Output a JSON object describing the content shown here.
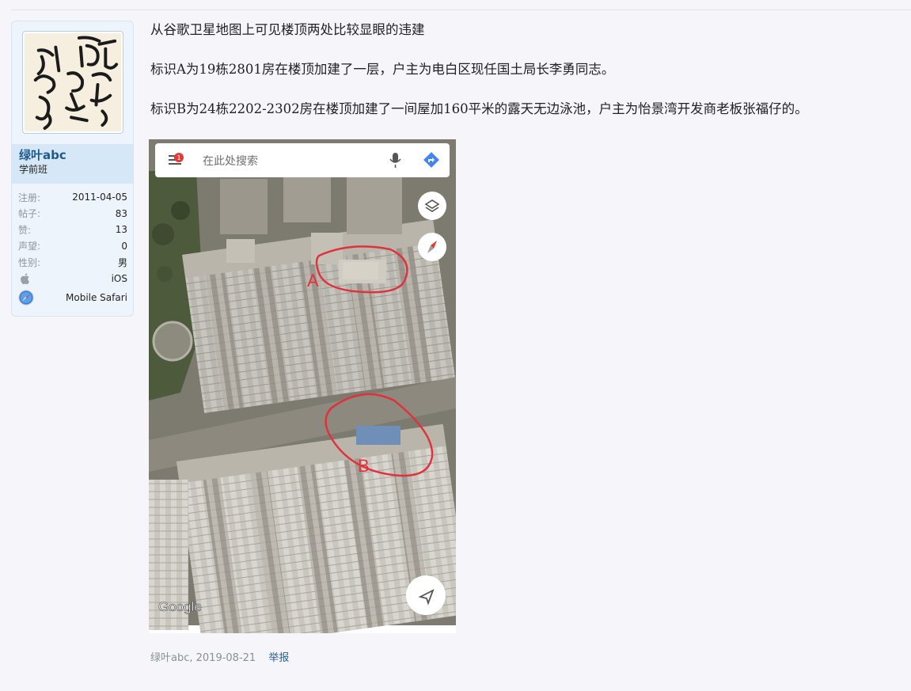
{
  "user": {
    "name": "绿叶abc",
    "title": "学前班",
    "stats": [
      {
        "label": "注册:",
        "value": "2011-04-05"
      },
      {
        "label": "帖子:",
        "value": "83"
      },
      {
        "label": "赞:",
        "value": "13"
      },
      {
        "label": "声望:",
        "value": "0"
      },
      {
        "label": "性别:",
        "value": "男"
      }
    ],
    "platform": {
      "icon": "apple-icon",
      "value": "iOS"
    },
    "browser": {
      "icon": "safari-icon",
      "value": "Mobile Safari"
    }
  },
  "post": {
    "paragraphs": [
      "从谷歌卫星地图上可见楼顶两处比较显眼的违建",
      "标识A为19栋2801房在楼顶加建了一层，户主为电白区现任国土局长李勇同志。",
      "标识B为24栋2202-2302房在楼顶加建了一间屋加160平米的露天无边泳池，户主为怡景湾开发商老板张福仔的。"
    ],
    "screenshot": {
      "search_placeholder": "在此处搜索",
      "notification_count": "1",
      "marker_a": "A",
      "marker_b": "B",
      "map_logo": "Google"
    }
  },
  "footer": {
    "meta": "绿叶abc, 2019-08-21",
    "report_label": "举报"
  },
  "colors": {
    "page_bg": "#f5f5fa",
    "username": "#1f5a8e",
    "annotation": "#e0323c",
    "link": "#2a5f93"
  }
}
